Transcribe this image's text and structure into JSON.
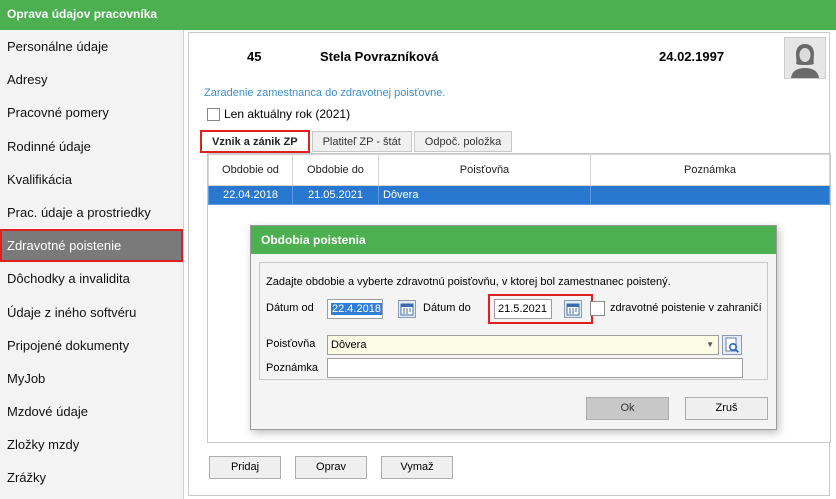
{
  "window": {
    "title": "Oprava údajov pracovníka"
  },
  "sidebar": {
    "items": [
      {
        "label": "Personálne údaje"
      },
      {
        "label": "Adresy"
      },
      {
        "label": "Pracovné pomery"
      },
      {
        "label": "Rodinné údaje"
      },
      {
        "label": "Kvalifikácia"
      },
      {
        "label": "Prac. údaje a prostriedky"
      },
      {
        "label": "Zdravotné poistenie"
      },
      {
        "label": "Dôchodky a invalidita"
      },
      {
        "label": "Údaje z iného softvéru"
      },
      {
        "label": "Pripojené dokumenty"
      },
      {
        "label": "MyJob"
      },
      {
        "label": "Mzdové údaje"
      },
      {
        "label": "Zložky mzdy"
      },
      {
        "label": "Zrážky"
      }
    ],
    "active_index": 6
  },
  "employee": {
    "id": "45",
    "name": "Stela Povrazníková",
    "birth_date": "24.02.1997"
  },
  "section": {
    "subtitle": "Zaradenie zamestnanca do zdravotnej poisťovne.",
    "current_year_checkbox_label": "Len aktuálny rok (2021)"
  },
  "tabs": [
    {
      "label": "Vznik a zánik ZP",
      "active": true
    },
    {
      "label": "Platiteľ ZP - štát",
      "active": false
    },
    {
      "label": "Odpoč. položka",
      "active": false
    }
  ],
  "grid": {
    "columns": [
      "Obdobie od",
      "Obdobie do",
      "Poisťovňa",
      "Poznámka"
    ],
    "rows": [
      {
        "from": "22.04.2018",
        "to": "21.05.2021",
        "insurer": "Dôvera",
        "note": ""
      }
    ]
  },
  "buttons": {
    "add": "Pridaj",
    "edit": "Oprav",
    "delete": "Vymaž"
  },
  "dialog": {
    "title": "Obdobia poistenia",
    "instruction": "Zadajte obdobie a vyberte zdravotnú poisťovňu, v ktorej bol zamestnanec poistený.",
    "date_from_label": "Dátum od",
    "date_from_value": "22.4.2018",
    "date_to_label": "Dátum do",
    "date_to_value": "21.5.2021",
    "abroad_label": "zdravotné poistenie v zahraničí",
    "insurer_label": "Poisťovňa",
    "insurer_value": "Dôvera",
    "note_label": "Poznámka",
    "note_value": "",
    "ok_label": "Ok",
    "cancel_label": "Zruš"
  },
  "colors": {
    "accent_green": "#4caf50",
    "selection_blue": "#2878d0",
    "highlight_red": "#e02020",
    "subtitle_blue": "#3c8ed3"
  }
}
